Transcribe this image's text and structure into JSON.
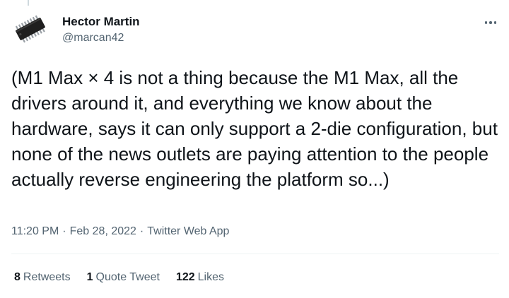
{
  "tweet": {
    "author": {
      "name": "Hector Martin",
      "handle": "@marcan42"
    },
    "text": "(M1 Max × 4 is not a thing because the M1 Max, all the drivers around it, and everything we know about the hardware, says it can only support a 2-die configuration, but none of the news outlets are paying attention to the people actually reverse engineering the platform so...)",
    "time": "11:20 PM",
    "date": "Feb 28, 2022",
    "source": "Twitter Web App",
    "separator": "·",
    "stats": {
      "retweets_count": "8",
      "retweets_label": "Retweets",
      "quotes_count": "1",
      "quotes_label": "Quote Tweet",
      "likes_count": "122",
      "likes_label": "Likes"
    }
  }
}
